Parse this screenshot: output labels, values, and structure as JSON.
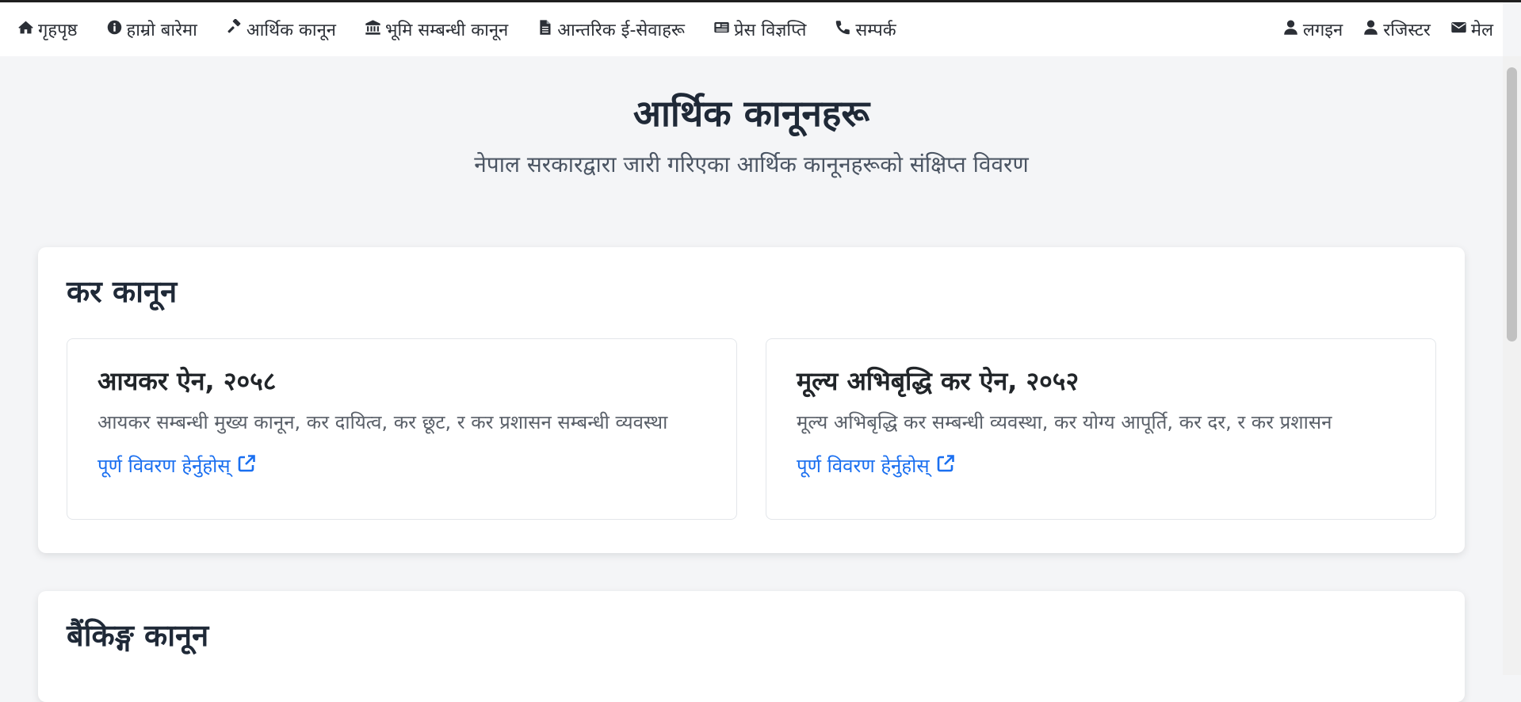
{
  "nav": {
    "left": [
      {
        "label": "गृहपृष्ठ",
        "icon": "home-icon"
      },
      {
        "label": "हाम्रो बारेमा",
        "icon": "info-circle-icon"
      },
      {
        "label": "आर्थिक कानून",
        "icon": "gavel-icon"
      },
      {
        "label": "भूमि सम्बन्धी कानून",
        "icon": "bank-icon"
      },
      {
        "label": "आन्तरिक ई-सेवाहरू",
        "icon": "document-icon"
      },
      {
        "label": "प्रेस विज्ञप्ति",
        "icon": "newspaper-icon"
      },
      {
        "label": "सम्पर्क",
        "icon": "phone-icon"
      }
    ],
    "right": [
      {
        "label": "लगइन",
        "icon": "user-icon"
      },
      {
        "label": "रजिस्टर",
        "icon": "user-icon"
      },
      {
        "label": "मेल",
        "icon": "envelope-icon"
      }
    ]
  },
  "page": {
    "title": "आर्थिक कानूनहरू",
    "subtitle": "नेपाल सरकारद्वारा जारी गरिएका आर्थिक कानूनहरूको संक्षिप्त विवरण"
  },
  "sections": [
    {
      "title": "कर कानून",
      "cards": [
        {
          "title": "आयकर ऐन, २०५८",
          "description": "आयकर सम्बन्धी मुख्य कानून, कर दायित्व, कर छूट, र कर प्रशासन सम्बन्धी व्यवस्था",
          "link": "पूर्ण विवरण हेर्नुहोस्"
        },
        {
          "title": "मूल्य अभिबृद्धि कर ऐन, २०५२",
          "description": "मूल्य अभिबृद्धि कर सम्बन्धी व्यवस्था, कर योग्य आपूर्ति, कर दर, र कर प्रशासन",
          "link": "पूर्ण विवरण हेर्नुहोस्"
        }
      ]
    },
    {
      "title": "बैंकिङ्ग कानून",
      "cards": []
    }
  ],
  "colors": {
    "link": "#1a6ff0",
    "background": "#f4f5f7",
    "heading": "#1f2937"
  }
}
